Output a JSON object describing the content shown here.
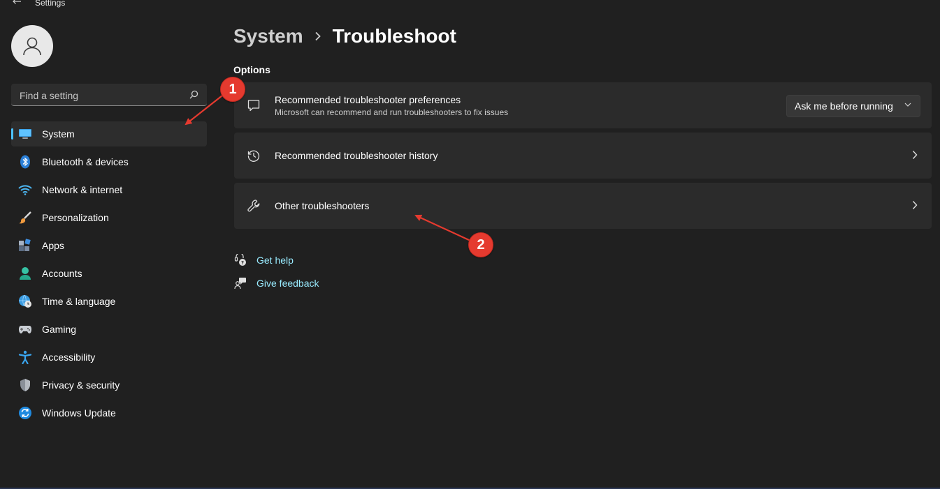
{
  "window": {
    "title": "Settings"
  },
  "search": {
    "placeholder": "Find a setting"
  },
  "sidebar": {
    "items": [
      {
        "label": "System",
        "icon": "monitor-icon",
        "active": true
      },
      {
        "label": "Bluetooth & devices",
        "icon": "bluetooth-icon"
      },
      {
        "label": "Network & internet",
        "icon": "wifi-icon"
      },
      {
        "label": "Personalization",
        "icon": "brush-icon"
      },
      {
        "label": "Apps",
        "icon": "apps-icon"
      },
      {
        "label": "Accounts",
        "icon": "person-icon"
      },
      {
        "label": "Time & language",
        "icon": "globe-clock-icon"
      },
      {
        "label": "Gaming",
        "icon": "gamepad-icon"
      },
      {
        "label": "Accessibility",
        "icon": "accessibility-icon"
      },
      {
        "label": "Privacy & security",
        "icon": "shield-icon"
      },
      {
        "label": "Windows Update",
        "icon": "update-icon"
      }
    ]
  },
  "breadcrumb": {
    "parent": "System",
    "current": "Troubleshoot"
  },
  "main": {
    "section_title": "Options",
    "cards": [
      {
        "title": "Recommended troubleshooter preferences",
        "subtitle": "Microsoft can recommend and run troubleshooters to fix issues",
        "icon": "chat-icon",
        "dropdown": "Ask me before running"
      },
      {
        "title": "Recommended troubleshooter history",
        "icon": "history-icon"
      },
      {
        "title": "Other troubleshooters",
        "icon": "wrench-icon"
      }
    ]
  },
  "links": {
    "get_help": "Get help",
    "give_feedback": "Give feedback"
  },
  "annotations": {
    "first": "1",
    "second": "2"
  },
  "colors": {
    "accent": "#4cc2ff",
    "link": "#99ebff",
    "annotation": "#e53a2f",
    "background": "#202020",
    "card": "#2b2b2b"
  }
}
